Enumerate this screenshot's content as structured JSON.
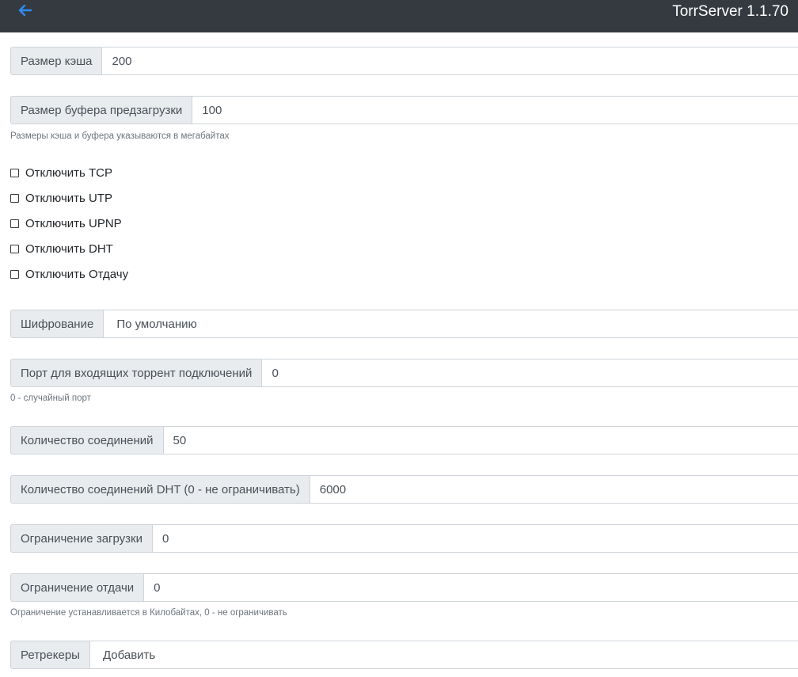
{
  "header": {
    "title": "TorrServer 1.1.70",
    "back_icon": "arrow-left-icon",
    "accent_color": "#2f8cf5"
  },
  "settings": {
    "cache_size": {
      "label": "Размер кэша",
      "value": "200"
    },
    "preload_buffer": {
      "label": "Размер буфера предзагрузки",
      "value": "100"
    },
    "size_hint": "Размеры кэша и буфера указываются в мегабайтах",
    "checkboxes": [
      {
        "label": "Отключить TCP",
        "checked": false
      },
      {
        "label": "Отключить UTP",
        "checked": false
      },
      {
        "label": "Отключить UPNP",
        "checked": false
      },
      {
        "label": "Отключить DHT",
        "checked": false
      },
      {
        "label": "Отключить Отдачу",
        "checked": false
      }
    ],
    "encryption": {
      "label": "Шифрование",
      "value": "По умолчанию"
    },
    "incoming_port": {
      "label": "Порт для входящих торрент подключений",
      "value": "0"
    },
    "port_hint": "0 - случайный порт",
    "connections": {
      "label": "Количество соединений",
      "value": "50"
    },
    "dht_connections": {
      "label": "Количество соединений DHT (0 - не ограничивать)",
      "value": "6000"
    },
    "download_limit": {
      "label": "Ограничение загрузки",
      "value": "0"
    },
    "upload_limit": {
      "label": "Ограничение отдачи",
      "value": "0"
    },
    "limit_hint": "Ограничение устанавливается в Килобайтах, 0 - не ограничивать",
    "retrackers": {
      "label": "Ретрекеры",
      "value": "Добавить"
    }
  }
}
